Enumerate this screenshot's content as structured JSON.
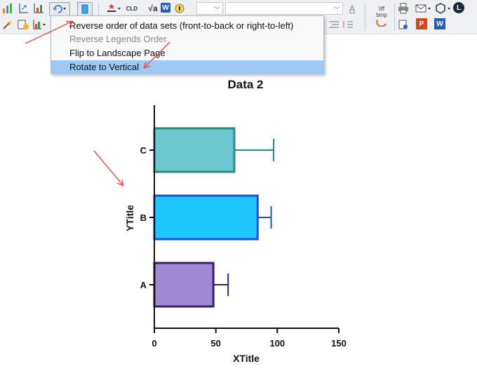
{
  "toolbar": {
    "icons": [
      "chart-icon",
      "axis-rescale-icon",
      "bar-chart-icon",
      "rotate-icon",
      "page-icon",
      "color-icon",
      "legend-icon",
      "equation-icon",
      "word-icon",
      "info-icon",
      "font-color-icon",
      "tiff-bmp-icon",
      "print-icon",
      "email-icon",
      "settings-icon",
      "l-icon",
      "powerpoint-icon",
      "word-export-icon"
    ],
    "tiff_label": "tiff",
    "bmp_label": "bmp",
    "cld_label": "CLD",
    "sqrt_label": "√a",
    "w_label": "W",
    "p_label": "P",
    "l_label": "L",
    "font_a_label": "A"
  },
  "context_menu": {
    "items": [
      {
        "label": "Reverse order of data sets (front-to-back or right-to-left)",
        "enabled": true,
        "highlighted": false
      },
      {
        "label": "Reverse Legends Order",
        "enabled": false,
        "highlighted": false
      },
      {
        "label": "Flip to Landscape Page",
        "enabled": true,
        "highlighted": false
      },
      {
        "label": "Rotate to Vertical",
        "enabled": true,
        "highlighted": true
      }
    ]
  },
  "chart_data": {
    "type": "bar",
    "orientation": "horizontal",
    "title": "Data 2",
    "xlabel": "XTitle",
    "ylabel": "YTitle",
    "categories": [
      "A",
      "B",
      "C"
    ],
    "values": [
      48,
      84,
      65
    ],
    "error_plus": [
      12,
      11,
      32
    ],
    "xlim": [
      0,
      150
    ],
    "xticks": [
      0,
      50,
      100,
      150
    ],
    "colors": {
      "A": {
        "fill": "#a088d2",
        "stroke": "#3b1e6e"
      },
      "B": {
        "fill": "#1ec8ff",
        "stroke": "#1f4fd6"
      },
      "C": {
        "fill": "#6ec6d0",
        "stroke": "#2a8a85"
      }
    },
    "grid": false,
    "legend": "none"
  },
  "annotation_color": "#e8544e"
}
